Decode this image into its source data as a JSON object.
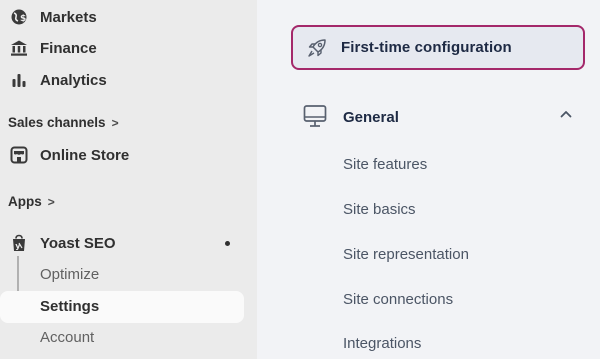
{
  "sidebar": {
    "items": [
      {
        "label": "Markets",
        "icon": "globe-dollar-icon"
      },
      {
        "label": "Finance",
        "icon": "bank-icon"
      },
      {
        "label": "Analytics",
        "icon": "bar-chart-icon"
      }
    ],
    "sales_channels": {
      "label": "Sales channels",
      "chevron": ">"
    },
    "online_store": {
      "label": "Online Store",
      "icon": "store-icon"
    },
    "apps": {
      "label": "Apps",
      "chevron": ">"
    },
    "yoast": {
      "label": "Yoast SEO",
      "icon": "yoast-bag-icon",
      "sub_items": [
        {
          "label": "Optimize",
          "active": false
        },
        {
          "label": "Settings",
          "active": true
        },
        {
          "label": "Account",
          "active": false
        }
      ]
    }
  },
  "main": {
    "first_time_config": {
      "label": "First-time configuration",
      "icon": "rocket-icon"
    },
    "general": {
      "label": "General",
      "icon": "monitor-icon",
      "expanded": true,
      "links": [
        "Site features",
        "Site basics",
        "Site representation",
        "Site connections",
        "Integrations"
      ]
    }
  },
  "colors": {
    "sidebar_bg": "#ebebeb",
    "main_bg": "#f2f3f6",
    "highlight_border": "#a4286a",
    "highlight_bg": "#e6e9f0"
  }
}
